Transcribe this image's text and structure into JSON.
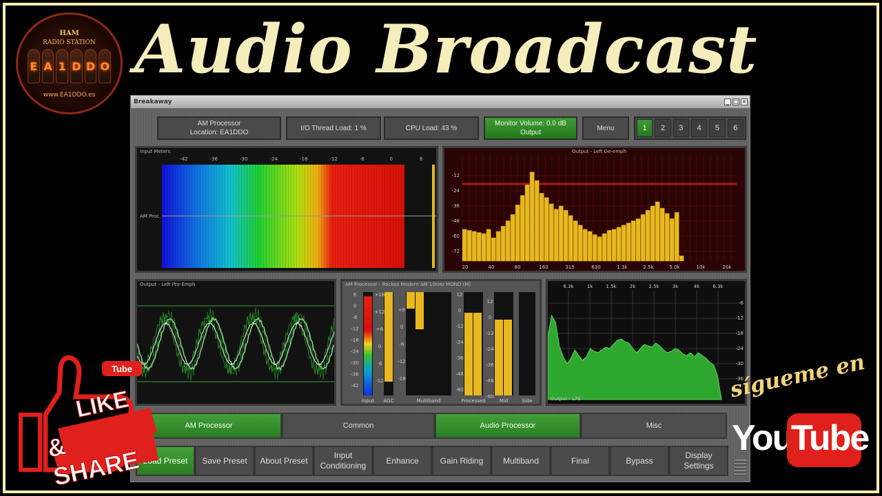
{
  "headline": "Audio Broadcast",
  "logo": {
    "line1": "HAM",
    "line2": "RADIO STATION",
    "callsign": [
      "E",
      "A",
      "1",
      "D",
      "D",
      "O"
    ],
    "url": "www.EA1DDO.es"
  },
  "window": {
    "title": "Breakaway",
    "controls": [
      "_",
      "□",
      "×"
    ],
    "status": {
      "processor": "AM Processor",
      "location": "Location: EA1DDO",
      "io_load": "I/O Thread Load: 1 %",
      "cpu_load": "CPU Load: 43 %",
      "monitor_volume": "Monitor Volume: 0.0 dB",
      "monitor_output": "Output",
      "menu": "Menu"
    },
    "presets": [
      "1",
      "2",
      "3",
      "4",
      "5",
      "6"
    ],
    "active_preset": "1",
    "input_meters": {
      "title": "Input Meters",
      "ticks": [
        "-42",
        "-36",
        "-30",
        "-24",
        "-18",
        "-12",
        "-6",
        "0",
        "6"
      ],
      "channel_label": "AM Proc."
    },
    "spectrum": {
      "title": "Output - Left De-emph",
      "y_ticks": [
        "-12",
        "-24",
        "-36",
        "-48",
        "-60",
        "-72"
      ],
      "x_ticks": [
        "20",
        "40",
        "80",
        "160",
        "315",
        "630",
        "1.3k",
        "2.5k",
        "5.0k",
        "10k",
        "20k"
      ]
    },
    "scope": {
      "title": "Output - Left Pre-Emph"
    },
    "processor_meters": {
      "title": "AM Processor - Rockos Modern AM 10kHz MONO (M)",
      "input_ticks": [
        "6",
        "0",
        "-6",
        "-12",
        "-18",
        "-24",
        "-30",
        "-36",
        "-42"
      ],
      "agc_ticks": [
        "+18",
        "+12",
        "+6",
        "0",
        "-6",
        "-12"
      ],
      "multiband_ticks": [
        "+6",
        "0",
        "-6",
        "-12",
        "-18"
      ],
      "processed_ticks": [
        "12",
        "0",
        "-12",
        "-24",
        "-36",
        "-48",
        "-60"
      ],
      "labels": [
        "Input",
        "AGC",
        "Multiband",
        "Processed",
        "Mid",
        "Side"
      ]
    },
    "lpe": {
      "title": "Output - LPE",
      "x_ticks": [
        "6.3k",
        "1k",
        "1.5k",
        "2k",
        "2.5k",
        "3k",
        "4k",
        "6.3k"
      ],
      "y_ticks": [
        "-6",
        "-12",
        "-18",
        "-24",
        "-30",
        "-36"
      ]
    },
    "tabs_left": [
      "AM Processor",
      "Common"
    ],
    "tabs_right": [
      "Audio Processor",
      "Misc"
    ],
    "bottom_buttons": [
      "Load Preset",
      "Save Preset",
      "About Preset",
      "Input Conditioning",
      "Enhance",
      "Gain Riding",
      "Multiband",
      "Final",
      "Bypass",
      "Display Settings"
    ]
  },
  "promo": {
    "tube_badge": "Tube",
    "like": "LIKE",
    "share": "& SHARE",
    "sigueme": "sígueme en",
    "you": "You",
    "tube": "Tube"
  },
  "colors": {
    "accent_green": "#2f8a27",
    "frame": "#f4ebb4",
    "meter_yellow": "#e8b820"
  }
}
